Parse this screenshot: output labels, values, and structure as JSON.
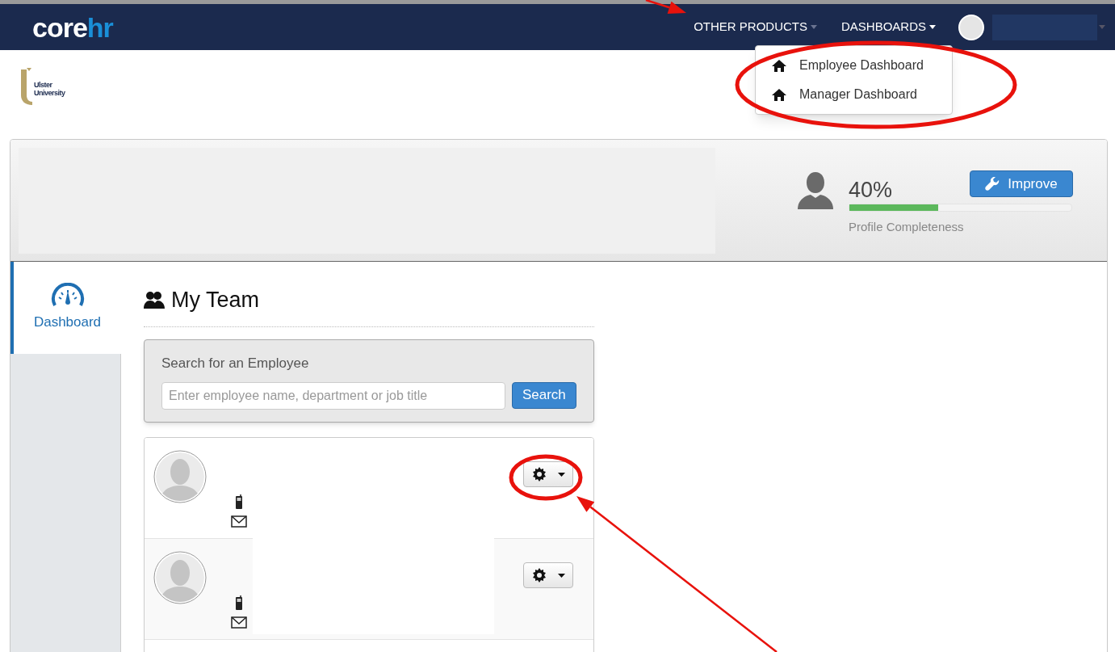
{
  "brand": {
    "part_1": "core",
    "part_2": "hr"
  },
  "nav": [
    {
      "label": "OTHER PRODUCTS",
      "expanded": false
    },
    {
      "label": "DASHBOARDS",
      "expanded": true
    }
  ],
  "dropdown": [
    {
      "label": "Employee Dashboard"
    },
    {
      "label": "Manager Dashboard"
    }
  ],
  "org_logo": {
    "line_1": "Ulster",
    "line_2": "University"
  },
  "profile": {
    "percent": "40%",
    "level": 0.4,
    "caption": "Profile Completeness",
    "button": "Improve"
  },
  "sidebar": [
    {
      "label": "Dashboard",
      "selected": true
    }
  ],
  "team": {
    "title": "My Team",
    "search": {
      "label": "Search for an Employee",
      "placeholder": "Enter employee name, department or job title",
      "button": "Search"
    },
    "members": [
      {
        "kind": "employee"
      },
      {
        "kind": "employee"
      }
    ]
  },
  "annotations": [
    {
      "kind": "arrow"
    },
    {
      "kind": "ellipse"
    },
    {
      "kind": "ellipse"
    },
    {
      "kind": "arrow"
    }
  ]
}
